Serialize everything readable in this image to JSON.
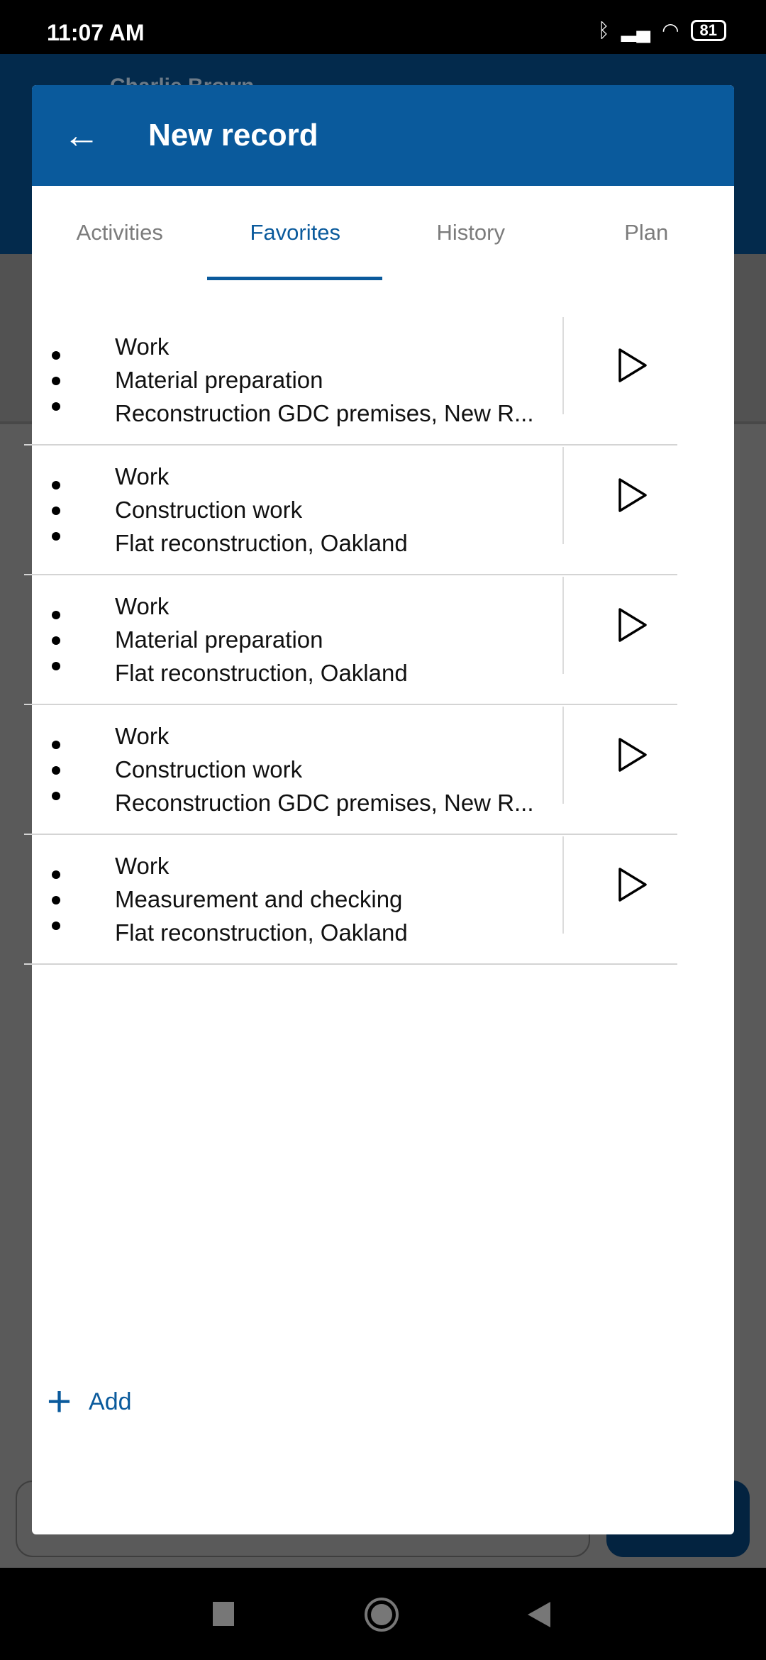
{
  "status_bar": {
    "time": "11:07 AM",
    "battery": "81",
    "icons": [
      "bluetooth-icon",
      "signal-icon",
      "wifi-icon",
      "battery-icon"
    ]
  },
  "background": {
    "user_name": "Charlie Brown"
  },
  "dialog": {
    "title": "New record",
    "tabs": [
      {
        "label": "Activities",
        "active": false
      },
      {
        "label": "Favorites",
        "active": true
      },
      {
        "label": "History",
        "active": false
      },
      {
        "label": "Plan",
        "active": false
      }
    ],
    "items": [
      {
        "type": "Work",
        "activity": "Material preparation",
        "project": "Reconstruction GDC premises, New R..."
      },
      {
        "type": "Work",
        "activity": "Construction work",
        "project": "Flat reconstruction, Oakland"
      },
      {
        "type": "Work",
        "activity": "Material preparation",
        "project": "Flat reconstruction, Oakland"
      },
      {
        "type": "Work",
        "activity": "Construction work",
        "project": "Reconstruction GDC premises, New R..."
      },
      {
        "type": "Work",
        "activity": "Measurement and checking",
        "project": "Flat reconstruction, Oakland"
      }
    ],
    "add_label": "Add"
  },
  "colors": {
    "primary": "#0a5a9c"
  }
}
